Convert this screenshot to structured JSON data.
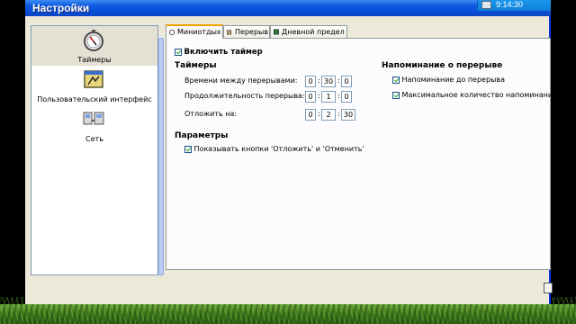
{
  "window": {
    "title": "Настройки"
  },
  "tray": {
    "time": "9:14:30"
  },
  "sidebar": {
    "items": [
      {
        "label": "Таймеры",
        "icon": "stopwatch-icon",
        "selected": true
      },
      {
        "label": "Пользовательский интерфейс",
        "icon": "ui-icon",
        "selected": false
      },
      {
        "label": "Сеть",
        "icon": "network-icon",
        "selected": false
      }
    ]
  },
  "tabs": [
    {
      "label": "Миниотдых",
      "active": true
    },
    {
      "label": "Перерыв",
      "active": false
    },
    {
      "label": "Дневной предел",
      "active": false
    }
  ],
  "settings": {
    "enable_timer": {
      "label": "Включить таймер",
      "checked": true
    },
    "timers": {
      "heading": "Таймеры",
      "rows": [
        {
          "label": "Времени между перерывами:",
          "h": "0",
          "m": "30",
          "s": "0"
        },
        {
          "label": "Продолжительность перерыва:",
          "h": "0",
          "m": "1",
          "s": "0"
        },
        {
          "label": "Отложить на:",
          "h": "0",
          "m": "2",
          "s": "30"
        }
      ]
    },
    "reminder": {
      "heading": "Напоминание о перерыве",
      "options": [
        {
          "label": "Напоминание до перерыва",
          "checked": true
        },
        {
          "label": "Максимальное количество напоминани",
          "checked": true
        }
      ]
    },
    "params": {
      "heading": "Параметры",
      "show_buttons": {
        "label": "Показывать кнопки 'Отложить' и 'Отменить'",
        "checked": true
      }
    }
  },
  "colors": {
    "titlebar": "#0a4ed6",
    "window_bg": "#ece9d8",
    "active_tab_accent": "#f0a000"
  }
}
